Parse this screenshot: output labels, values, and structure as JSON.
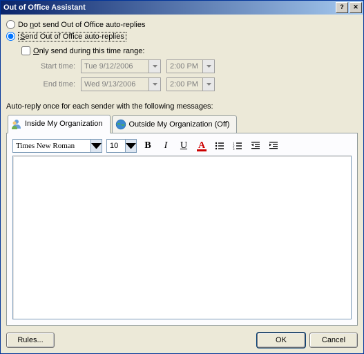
{
  "title": "Out of Office Assistant",
  "radio_do_not_send": "Do not send Out of Office auto-replies",
  "radio_do_not_send_accesskey": "n",
  "radio_send": "Send Out of Office auto-replies",
  "radio_send_accesskey": "S",
  "radio_selected": "send",
  "only_send_label": "Only send during this time range:",
  "only_send_accesskey": "O",
  "only_send_checked": false,
  "start_time_label": "Start time:",
  "start_date": "Tue 9/12/2006",
  "start_time": "2:00 PM",
  "end_time_label": "End time:",
  "end_date": "Wed 9/13/2006",
  "end_time": "2:00 PM",
  "section_label": "Auto-reply once for each sender with the following messages:",
  "tabs": {
    "inside": "Inside My Organization",
    "outside": "Outside My Organization (Off)"
  },
  "active_tab": "inside",
  "toolbar": {
    "font": "Times New Roman",
    "size": "10",
    "bold": "B",
    "italic": "I",
    "underline": "U",
    "color": "A"
  },
  "editor_content": "",
  "buttons": {
    "rules": "Rules...",
    "ok": "OK",
    "cancel": "Cancel"
  },
  "titlebar_buttons": {
    "help": "?",
    "close": "✕"
  }
}
